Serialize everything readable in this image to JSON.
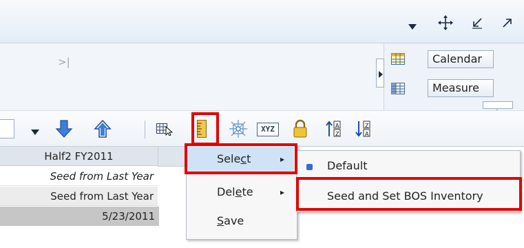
{
  "top_bar": {
    "icons": [
      "dropdown-arrow-icon",
      "move-icon",
      "arrow-down-left-icon",
      "arrow-up-right-icon"
    ]
  },
  "panel": {
    "collapse_glyph": ">|"
  },
  "dimension_panel": {
    "items": [
      {
        "label": "Calendar",
        "icon": "calendar-grid-icon"
      },
      {
        "label": "Measure",
        "icon": "measure-grid-icon"
      }
    ]
  },
  "toolbar": {
    "icons": [
      "dropdown-arrow-icon",
      "move-down-icon",
      "move-up-icon",
      "select-pointer-icon",
      "ruler-icon",
      "spark-icon",
      "xyz-icon",
      "lock-icon",
      "sort-ascending-icon",
      "sort-descending-icon"
    ],
    "xyz_label": "XYZ"
  },
  "grid": {
    "header": "Half2 FY2011",
    "rows": [
      "Seed from Last Year",
      "Seed from Last Year",
      "5/23/2011"
    ]
  },
  "context_menu": {
    "items": [
      {
        "label_pre": "Sele",
        "hotkey": "c",
        "label_post": "t",
        "has_submenu": true,
        "highlighted": true
      },
      {
        "label_pre": "Del",
        "hotkey": "e",
        "label_post": "te",
        "has_submenu": true,
        "highlighted": false
      },
      {
        "label_pre": "",
        "hotkey": "S",
        "label_post": "ave",
        "has_submenu": false,
        "highlighted": false
      }
    ],
    "submenu_arrow": "▸"
  },
  "submenu": {
    "items": [
      {
        "label": "Default",
        "selected": true
      },
      {
        "label": "Seed and Set BOS Inventory",
        "selected": false
      }
    ]
  },
  "colors": {
    "highlight": "#e30000",
    "menu_selected": "#cfe2f6",
    "accent_blue": "#2f6fd6"
  }
}
